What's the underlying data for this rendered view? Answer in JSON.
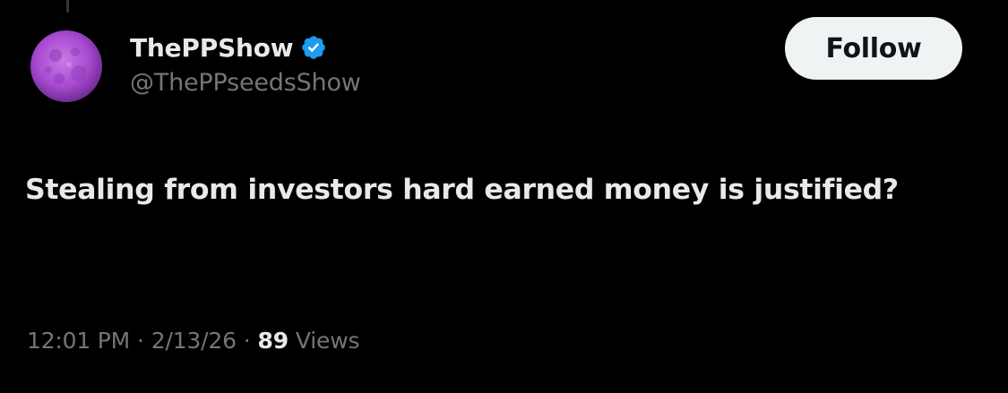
{
  "author": {
    "display_name": "ThePPShow",
    "handle": "@ThePPseedsShow",
    "verified": true,
    "avatar_icon": "purple-moon-avatar"
  },
  "follow_button": {
    "label": "Follow"
  },
  "tweet": {
    "text": "Stealing from investors hard earned money is justified?"
  },
  "meta": {
    "time": "12:01 PM",
    "separator": "·",
    "date": "2/13/26",
    "views_count": "89",
    "views_label": "Views"
  },
  "colors": {
    "background": "#000000",
    "primary_text": "#e7e9ea",
    "secondary_text": "#71767b",
    "verified_blue": "#1d9bf0",
    "button_bg": "#eff3f4",
    "button_text": "#0f1419",
    "avatar_purple": "#a84bd0"
  }
}
